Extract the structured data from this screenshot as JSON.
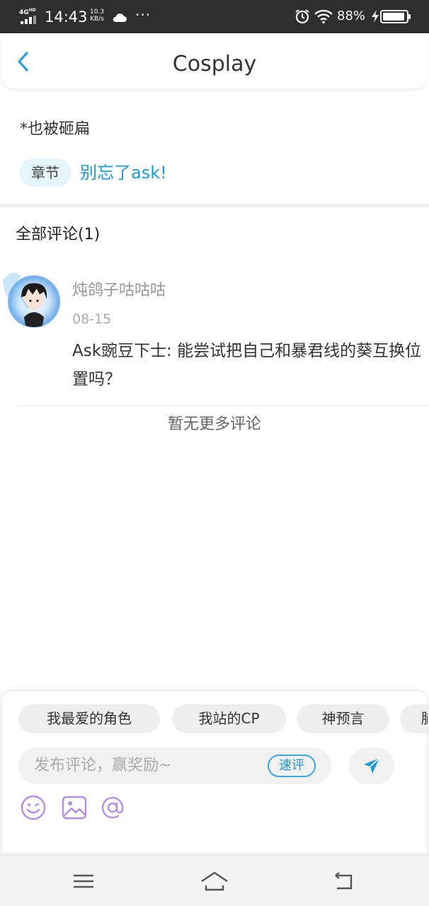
{
  "status_bar": {
    "network": "4G",
    "network_sup": "HD",
    "time": "14:43",
    "net_speed_value": "10.3",
    "net_speed_unit": "KB/s",
    "more_indicator": "···",
    "battery_percent": "88%",
    "icons": [
      "signal-icon",
      "cloud-icon",
      "alarm-icon",
      "wifi-icon",
      "charging-icon",
      "battery-icon"
    ]
  },
  "header": {
    "title": "Cosplay",
    "back_icon": "chevron-left-icon"
  },
  "post": {
    "text": "*也被砸扁",
    "tag_label": "章节",
    "chapter_link": "别忘了ask!"
  },
  "comments": {
    "title": "全部评论(1)",
    "items": [
      {
        "user": "炖鸽子咕咕咕",
        "date": "08-15",
        "body": "Ask豌豆下士: 能尝试把自己和暴君线的葵互换位置吗？"
      }
    ],
    "no_more": "暂无更多评论"
  },
  "composer": {
    "chips": [
      "我最爱的角色",
      "我站的CP",
      "神预言",
      "脑"
    ],
    "placeholder": "发布评论，赢奖励~",
    "quick_review": "速评",
    "tools": [
      "emoji-icon",
      "image-icon",
      "mention-icon"
    ]
  },
  "navbar": {
    "icons": [
      "menu-icon",
      "home-icon",
      "back-icon"
    ]
  },
  "colors": {
    "accent": "#1e9ad6",
    "tool_purple": "#b48ee6",
    "status_bar_bg": "#2e2e2e"
  }
}
